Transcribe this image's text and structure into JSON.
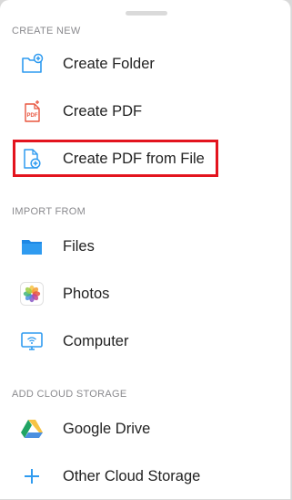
{
  "sections": [
    {
      "header": "CREATE NEW",
      "items": [
        {
          "label": "Create Folder",
          "icon": "folder-plus-icon"
        },
        {
          "label": "Create PDF",
          "icon": "pdf-document-icon"
        },
        {
          "label": "Create PDF from File",
          "icon": "file-plus-icon",
          "highlighted": true
        }
      ]
    },
    {
      "header": "IMPORT FROM",
      "items": [
        {
          "label": "Files",
          "icon": "files-folder-icon"
        },
        {
          "label": "Photos",
          "icon": "photos-app-icon"
        },
        {
          "label": "Computer",
          "icon": "monitor-wifi-icon"
        }
      ]
    },
    {
      "header": "ADD CLOUD STORAGE",
      "items": [
        {
          "label": "Google Drive",
          "icon": "google-drive-icon"
        },
        {
          "label": "Other Cloud Storage",
          "icon": "plus-icon"
        }
      ]
    }
  ],
  "colors": {
    "accent_blue": "#2f9bf0",
    "pdf_red": "#e8563f",
    "highlight_red": "#e3141e",
    "label_text": "#222222",
    "header_text": "#8a8a8e"
  }
}
